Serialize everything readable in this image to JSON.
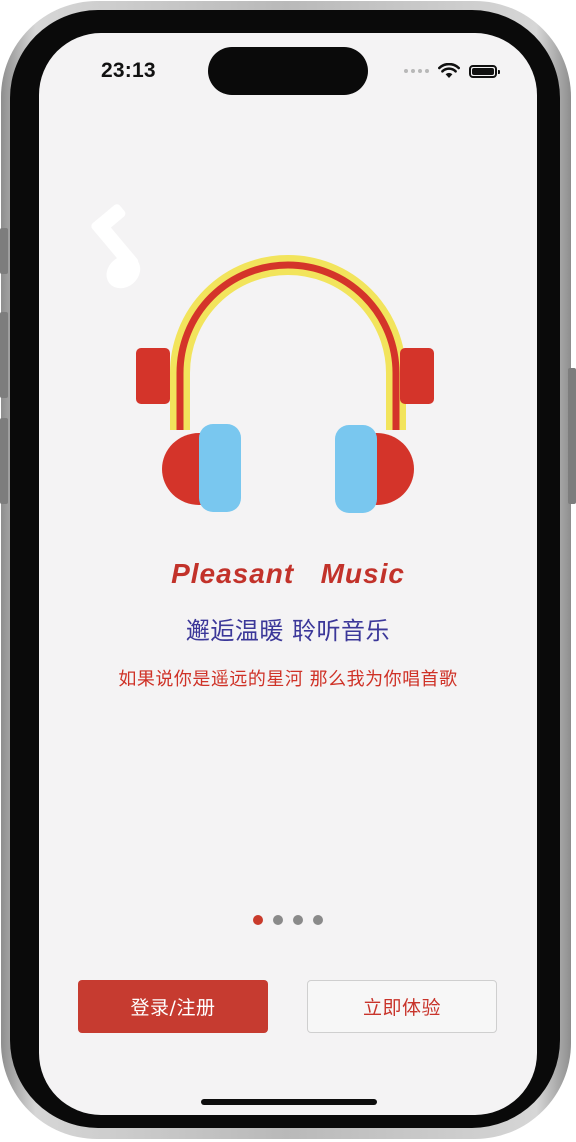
{
  "status_bar": {
    "time": "23:13"
  },
  "hero": {
    "icons": [
      "music-note-icon",
      "headphones-icon"
    ],
    "colors": {
      "headband_outer": "#f2e45c",
      "headband_inner": "#d4342a",
      "ear_cup": "#d4342a",
      "cushion": "#79c7ef"
    }
  },
  "brand": {
    "title": "Pleasant   Music",
    "subtitle": "邂逅温暖 聆听音乐",
    "tagline": "如果说你是遥远的星河 那么我为你唱首歌"
  },
  "pager": {
    "total": 4,
    "active_index": 0
  },
  "actions": {
    "login_label": "登录/注册",
    "try_label": "立即体验"
  },
  "colors": {
    "accent": "#c63b30",
    "subtitle": "#3b3799",
    "background": "#f4f3f4"
  }
}
